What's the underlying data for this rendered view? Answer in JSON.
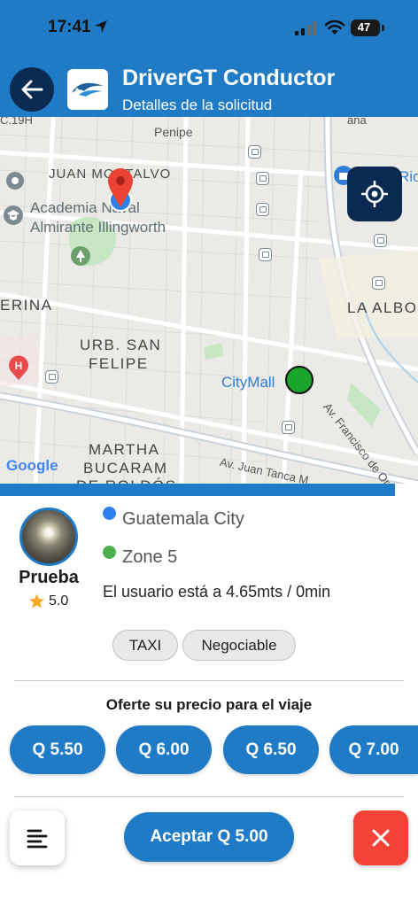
{
  "status_bar": {
    "time": "17:41",
    "battery": "47"
  },
  "header": {
    "title": "DriverGT Conductor",
    "subtitle": "Detalles de la solicitud"
  },
  "map": {
    "labels": {
      "c19h": "C.19H",
      "penipe": "Penipe",
      "juan_montalvo": "JUAN MONTALVO",
      "academia_line1": "Academia Naval",
      "academia_line2": "Almirante Illingworth",
      "erina": "ERINA",
      "urb_san_felipe_1": "URB. SAN",
      "urb_san_felipe_2": "FELIPE",
      "la_albo": "LA ALBO",
      "citymall": "CityMall",
      "av_francisco": "Av. Francisco de Orellana",
      "martha_1": "MARTHA",
      "martha_2": "BUCARAM",
      "martha_3": "DE ROLDÓS",
      "av_juan_tanca": "Av. Juan Tanca M",
      "ana": "ana",
      "ric": "Ric",
      "google": "Google"
    }
  },
  "request": {
    "user_name": "Prueba",
    "rating": "5.0",
    "origin": "Guatemala City",
    "destination": "Zone 5",
    "distance": "El usuario está a 4.65mts / 0min",
    "chips": [
      "TAXI",
      "Negociable"
    ]
  },
  "offer": {
    "title": "Oferte su precio para el viaje",
    "prices": [
      "Q 5.50",
      "Q 6.00",
      "Q 6.50",
      "Q 7.00"
    ]
  },
  "actions": {
    "accept_label": "Aceptar Q 5.00"
  },
  "colors": {
    "primary": "#1f7bc6",
    "dark_navy": "#0b2a52",
    "origin_dot": "#2f80ed",
    "destination_dot": "#4caf50",
    "cancel": "#f44336",
    "star": "#f5a623"
  },
  "icons": {
    "back": "arrow-left-icon",
    "locate": "crosshair-icon",
    "menu": "menu-lines-icon",
    "close": "close-icon",
    "star": "star-icon",
    "pin": "map-pin-icon"
  }
}
